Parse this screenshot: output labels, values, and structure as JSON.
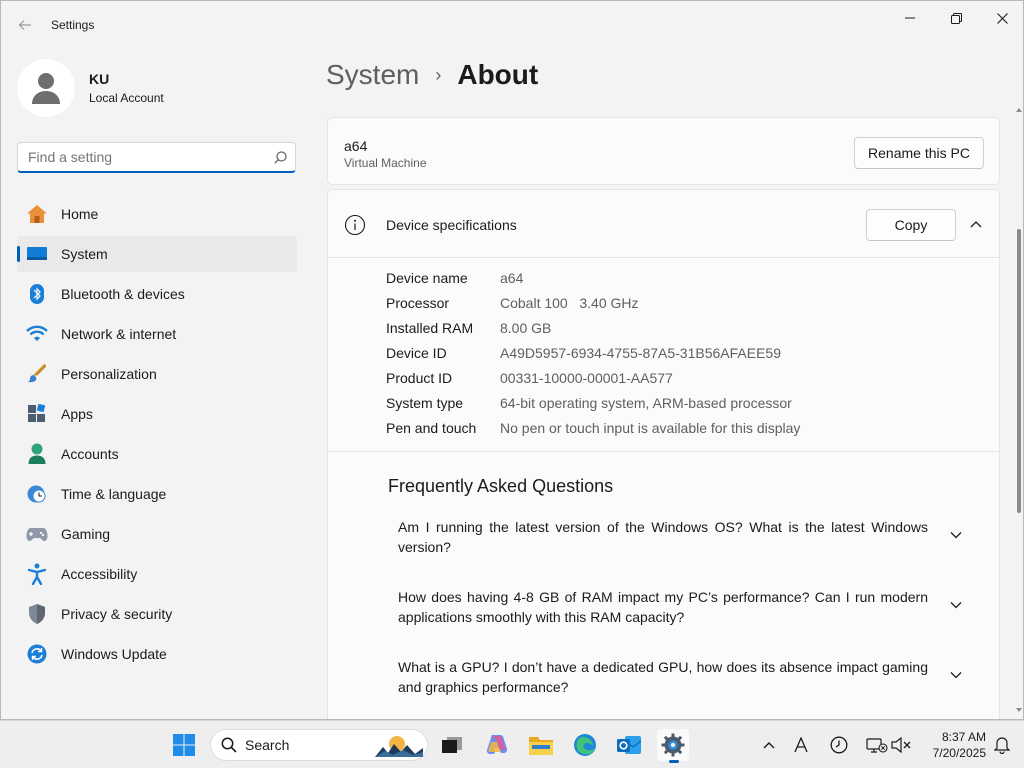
{
  "window": {
    "title": "Settings"
  },
  "profile": {
    "name": "KU",
    "account_type": "Local Account"
  },
  "search": {
    "placeholder": "Find a setting"
  },
  "sidebar": {
    "items": [
      {
        "label": "Home",
        "icon": "home-icon"
      },
      {
        "label": "System",
        "icon": "system-icon",
        "selected": true
      },
      {
        "label": "Bluetooth & devices",
        "icon": "bluetooth-icon"
      },
      {
        "label": "Network & internet",
        "icon": "wifi-icon"
      },
      {
        "label": "Personalization",
        "icon": "brush-icon"
      },
      {
        "label": "Apps",
        "icon": "apps-icon"
      },
      {
        "label": "Accounts",
        "icon": "accounts-icon"
      },
      {
        "label": "Time & language",
        "icon": "clock-globe-icon"
      },
      {
        "label": "Gaming",
        "icon": "gamepad-icon"
      },
      {
        "label": "Accessibility",
        "icon": "accessibility-icon"
      },
      {
        "label": "Privacy & security",
        "icon": "shield-icon"
      },
      {
        "label": "Windows Update",
        "icon": "update-icon"
      }
    ]
  },
  "breadcrumb": {
    "parent": "System",
    "separator": "›",
    "current": "About"
  },
  "pc": {
    "name": "a64",
    "type": "Virtual Machine",
    "rename_label": "Rename this PC"
  },
  "device_specs": {
    "title": "Device specifications",
    "copy_label": "Copy",
    "rows": [
      {
        "key": "Device name",
        "value": "a64"
      },
      {
        "key": "Processor",
        "value": "Cobalt 100   3.40 GHz"
      },
      {
        "key": "Installed RAM",
        "value": "8.00 GB"
      },
      {
        "key": "Device ID",
        "value": "A49D5957-6934-4755-87A5-31B56AFAEE59"
      },
      {
        "key": "Product ID",
        "value": "00331-10000-00001-AA577"
      },
      {
        "key": "System type",
        "value": "64-bit operating system, ARM-based processor"
      },
      {
        "key": "Pen and touch",
        "value": "No pen or touch input is available for this display"
      }
    ]
  },
  "faq": {
    "title": "Frequently Asked Questions",
    "items": [
      {
        "question": "Am I running the latest version of the Windows OS? What is the latest Windows version?"
      },
      {
        "question": "How does having 4-8 GB of RAM impact my PC’s performance? Can I run modern applications smoothly with this RAM capacity?"
      },
      {
        "question": "What is a GPU? I don’t have a dedicated GPU, how does its absence impact gaming and graphics performance?"
      }
    ]
  },
  "taskbar": {
    "search_label": "Search",
    "time": "8:37 AM",
    "date": "7/20/2025"
  },
  "colors": {
    "accent": "#005fb8",
    "background": "#f3f3f3",
    "card": "#fbfbfb"
  }
}
